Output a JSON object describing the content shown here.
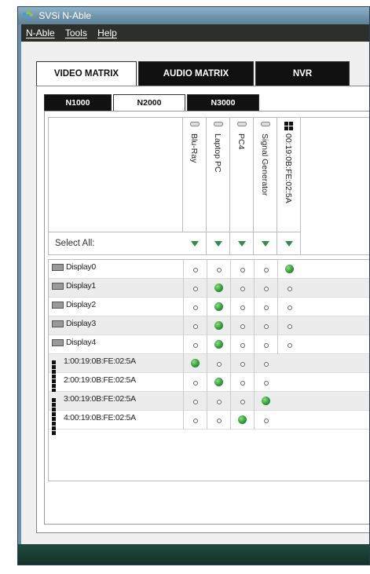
{
  "window": {
    "title": "SVSi N-Able"
  },
  "menu": [
    "N-Able",
    "Tools",
    "Help"
  ],
  "main_tabs": [
    {
      "label": "VIDEO MATRIX",
      "active": true
    },
    {
      "label": "AUDIO MATRIX",
      "active": false
    },
    {
      "label": "NVR",
      "active": false
    }
  ],
  "sub_tabs": [
    {
      "label": "N1000",
      "active": false
    },
    {
      "label": "N2000",
      "active": true
    },
    {
      "label": "N3000",
      "active": false
    }
  ],
  "columns": [
    {
      "label": "Blu-Ray",
      "icon": "encoder-icon"
    },
    {
      "label": "Laptop PC",
      "icon": "encoder-icon"
    },
    {
      "label": "PC4",
      "icon": "encoder-icon"
    },
    {
      "label": "Signal Generator",
      "icon": "encoder-icon"
    },
    {
      "label": "00:19:0B:FE:02:5A",
      "icon": "grid-icon"
    }
  ],
  "select_all_label": "Select All:",
  "rows": [
    {
      "label": "Display0",
      "icon": "display-icon",
      "selected": 4,
      "cells": 5
    },
    {
      "label": "Display1",
      "icon": "display-icon",
      "selected": 1,
      "cells": 5
    },
    {
      "label": "Display2",
      "icon": "display-icon",
      "selected": 1,
      "cells": 5
    },
    {
      "label": "Display3",
      "icon": "display-icon",
      "selected": 1,
      "cells": 5
    },
    {
      "label": "Display4",
      "icon": "display-icon",
      "selected": 1,
      "cells": 5
    },
    {
      "label": "1:00:19:0B:FE:02:5A",
      "icon": "grid-icon",
      "selected": 0,
      "cells": 4
    },
    {
      "label": "2:00:19:0B:FE:02:5A",
      "icon": "grid-icon",
      "selected": 1,
      "cells": 4
    },
    {
      "label": "3:00:19:0B:FE:02:5A",
      "icon": "grid-icon",
      "selected": 3,
      "cells": 4
    },
    {
      "label": "4:00:19:0B:FE:02:5A",
      "icon": "grid-icon",
      "selected": 2,
      "cells": 4
    }
  ]
}
